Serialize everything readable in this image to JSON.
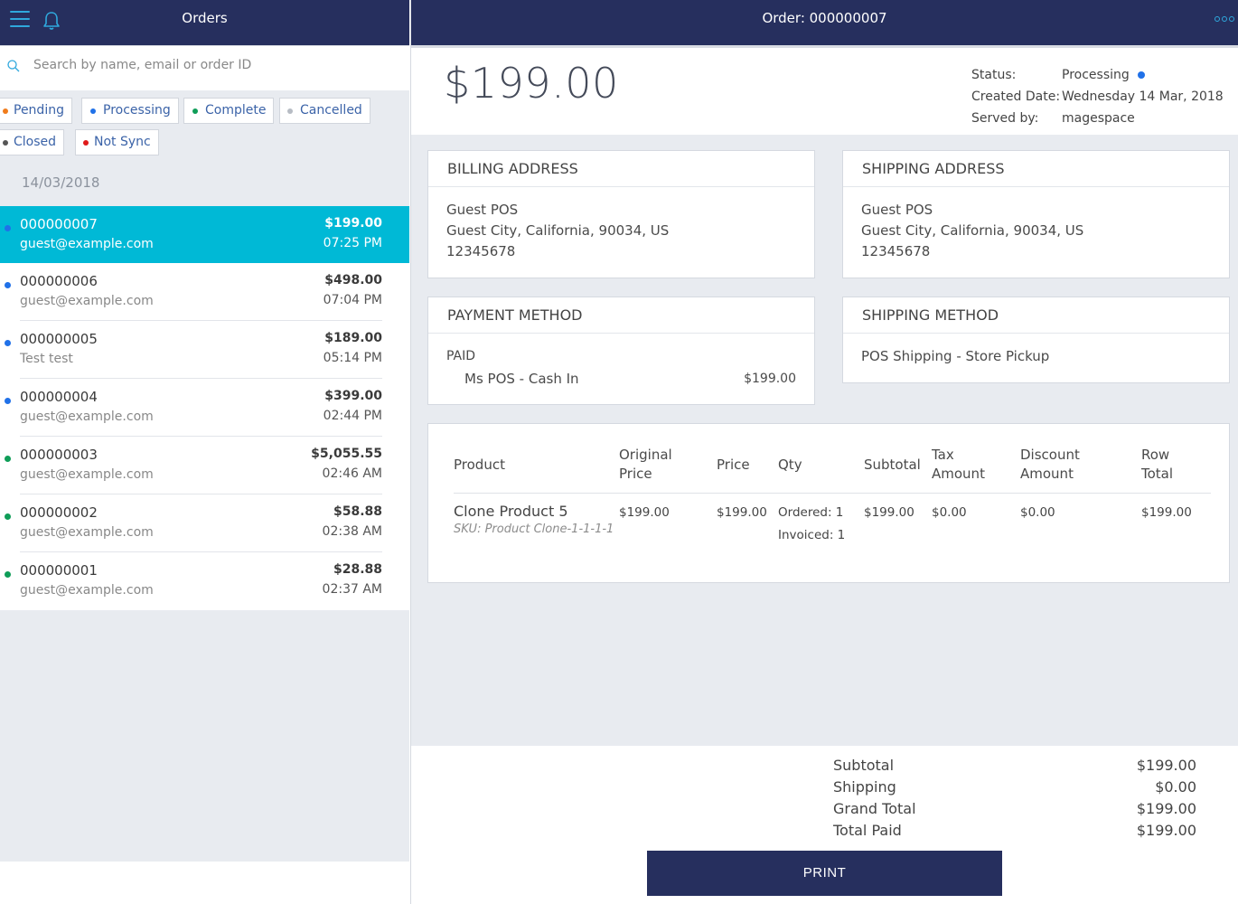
{
  "sidebar": {
    "title": "Orders",
    "search_placeholder": "Search by name, email or order ID",
    "filters": [
      {
        "label": "Pending",
        "color": "#f07c1b"
      },
      {
        "label": "Processing",
        "color": "#2071e8"
      },
      {
        "label": "Complete",
        "color": "#0f9d58"
      },
      {
        "label": "Cancelled",
        "color": "#b7bcc4"
      },
      {
        "label": "Closed",
        "color": "#555555"
      },
      {
        "label": "Not Sync",
        "color": "#e01919"
      }
    ],
    "date_group": "14/03/2018",
    "orders": [
      {
        "id": "000000007",
        "name": "guest@example.com",
        "amount": "$199.00",
        "time": "07:25 PM",
        "status_color": "#2071e8"
      },
      {
        "id": "000000006",
        "name": "guest@example.com",
        "amount": "$498.00",
        "time": "07:04 PM",
        "status_color": "#2071e8"
      },
      {
        "id": "000000005",
        "name": "Test test",
        "amount": "$189.00",
        "time": "05:14 PM",
        "status_color": "#2071e8"
      },
      {
        "id": "000000004",
        "name": "guest@example.com",
        "amount": "$399.00",
        "time": "02:44 PM",
        "status_color": "#2071e8"
      },
      {
        "id": "000000003",
        "name": "guest@example.com",
        "amount": "$5,055.55",
        "time": "02:46 AM",
        "status_color": "#0f9d58"
      },
      {
        "id": "000000002",
        "name": "guest@example.com",
        "amount": "$58.88",
        "time": "02:38 AM",
        "status_color": "#0f9d58"
      },
      {
        "id": "000000001",
        "name": "guest@example.com",
        "amount": "$28.88",
        "time": "02:37 AM",
        "status_color": "#0f9d58"
      }
    ]
  },
  "detail": {
    "title": "Order: 000000007",
    "grand_total": "$199.00",
    "status_label": "Status:",
    "status_value": "Processing",
    "created_label": "Created Date:",
    "created_value": "Wednesday 14 Mar, 2018",
    "served_label": "Served by:",
    "served_value": "magespace",
    "billing": {
      "heading": "BILLING ADDRESS",
      "name": "Guest POS",
      "address": "Guest City, California, 90034, US",
      "phone": "12345678"
    },
    "shipping": {
      "heading": "SHIPPING ADDRESS",
      "name": "Guest POS",
      "address": "Guest City, California, 90034, US",
      "phone": "12345678"
    },
    "payment": {
      "heading": "PAYMENT METHOD",
      "state": "PAID",
      "method": "Ms POS - Cash In",
      "amount": "$199.00"
    },
    "shipping_method": {
      "heading": "SHIPPING METHOD",
      "value": "POS Shipping - Store Pickup"
    },
    "items_table": {
      "headers": {
        "product": "Product",
        "original_price_1": "Original",
        "original_price_2": "Price",
        "price": "Price",
        "qty": "Qty",
        "subtotal": "Subtotal",
        "tax_1": "Tax",
        "tax_2": "Amount",
        "discount_1": "Discount",
        "discount_2": "Amount",
        "row_total_1": "Row",
        "row_total_2": "Total"
      },
      "rows": [
        {
          "product": "Clone Product 5",
          "sku_label": "SKU",
          "sku": ": Product Clone-1-1-1-1",
          "original_price": "$199.00",
          "price": "$199.00",
          "ordered": "Ordered: 1",
          "invoiced": "Invoiced: 1",
          "subtotal": "$199.00",
          "tax": "$0.00",
          "discount": "$0.00",
          "row_total": "$199.00"
        }
      ]
    },
    "totals": [
      {
        "label": "Subtotal",
        "value": "$199.00"
      },
      {
        "label": "Shipping",
        "value": "$0.00"
      },
      {
        "label": "Grand Total",
        "value": "$199.00"
      },
      {
        "label": "Total Paid",
        "value": "$199.00"
      }
    ],
    "print_label": "PRINT"
  }
}
